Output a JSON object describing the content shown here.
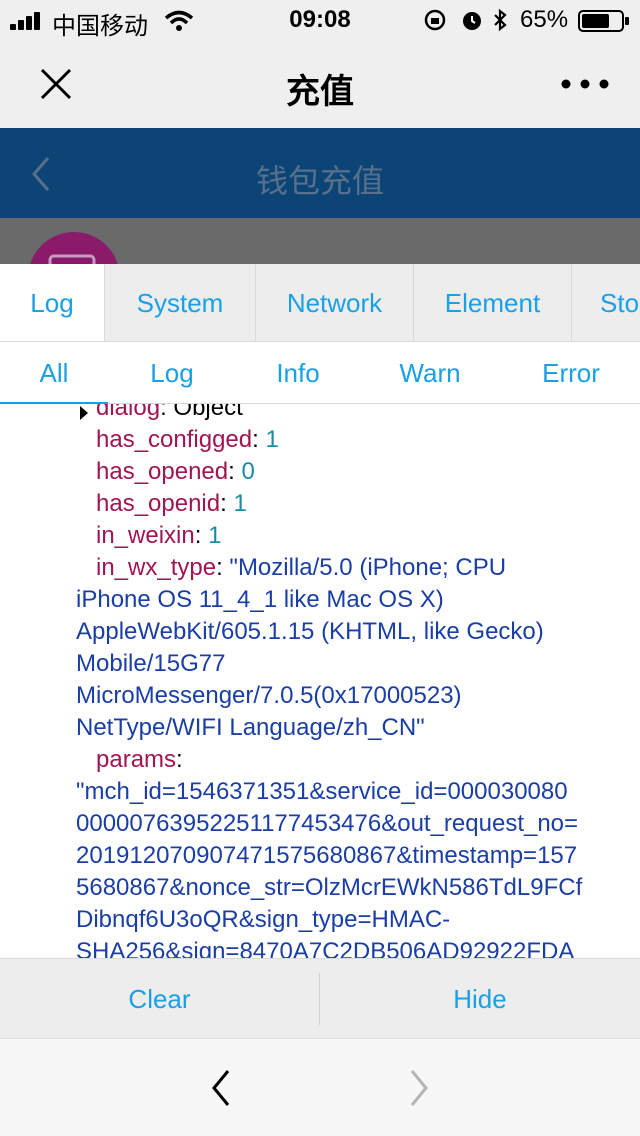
{
  "status_bar": {
    "carrier": "中国移动",
    "time": "09:08",
    "battery": "65%"
  },
  "wechat_nav": {
    "title": "充值"
  },
  "page_header": {
    "title": "钱包充值"
  },
  "vconsole": {
    "tabs": [
      "Log",
      "System",
      "Network",
      "Element",
      "Sto"
    ],
    "active_tab": "Log",
    "filters": [
      "All",
      "Log",
      "Info",
      "Warn",
      "Error"
    ],
    "active_filter": "All",
    "log": {
      "dialog_key": "dialog",
      "dialog_value": "Object",
      "has_configged_key": "has_configged",
      "has_configged_value": "1",
      "has_opened_key": "has_opened",
      "has_opened_value": "0",
      "has_openid_key": "has_openid",
      "has_openid_value": "1",
      "in_weixin_key": "in_weixin",
      "in_weixin_value": "1",
      "in_wx_type_key": "in_wx_type",
      "in_wx_type_lines": [
        "\"Mozilla/5.0 (iPhone; CPU",
        "iPhone OS 11_4_1 like Mac OS X)",
        "AppleWebKit/605.1.15 (KHTML, like Gecko)",
        "Mobile/15G77",
        "MicroMessenger/7.0.5(0x17000523)",
        "NetType/WIFI Language/zh_CN\""
      ],
      "params_key": "params",
      "params_lines": [
        "\"mch_id=1546371351&service_id=000030080",
        "00000763952251177453476&out_request_no=",
        "2019120709074715756808​67&timestamp=157",
        "5680867&nonce_str=OlzMcrEWkN586TdL9FCf",
        "Dibnqf6U3oQR&sign_type=HMAC-",
        "SHA256&sign=8470A7C2DB506AD92922FDA"
      ]
    },
    "clear_label": "Clear",
    "hide_label": "Hide"
  },
  "colors": {
    "header_bg": "#0d4476",
    "accent": "#1aa0e6",
    "key_color": "#a01552",
    "number_color": "#1a8aa6",
    "string_color": "#1a3ea6"
  }
}
